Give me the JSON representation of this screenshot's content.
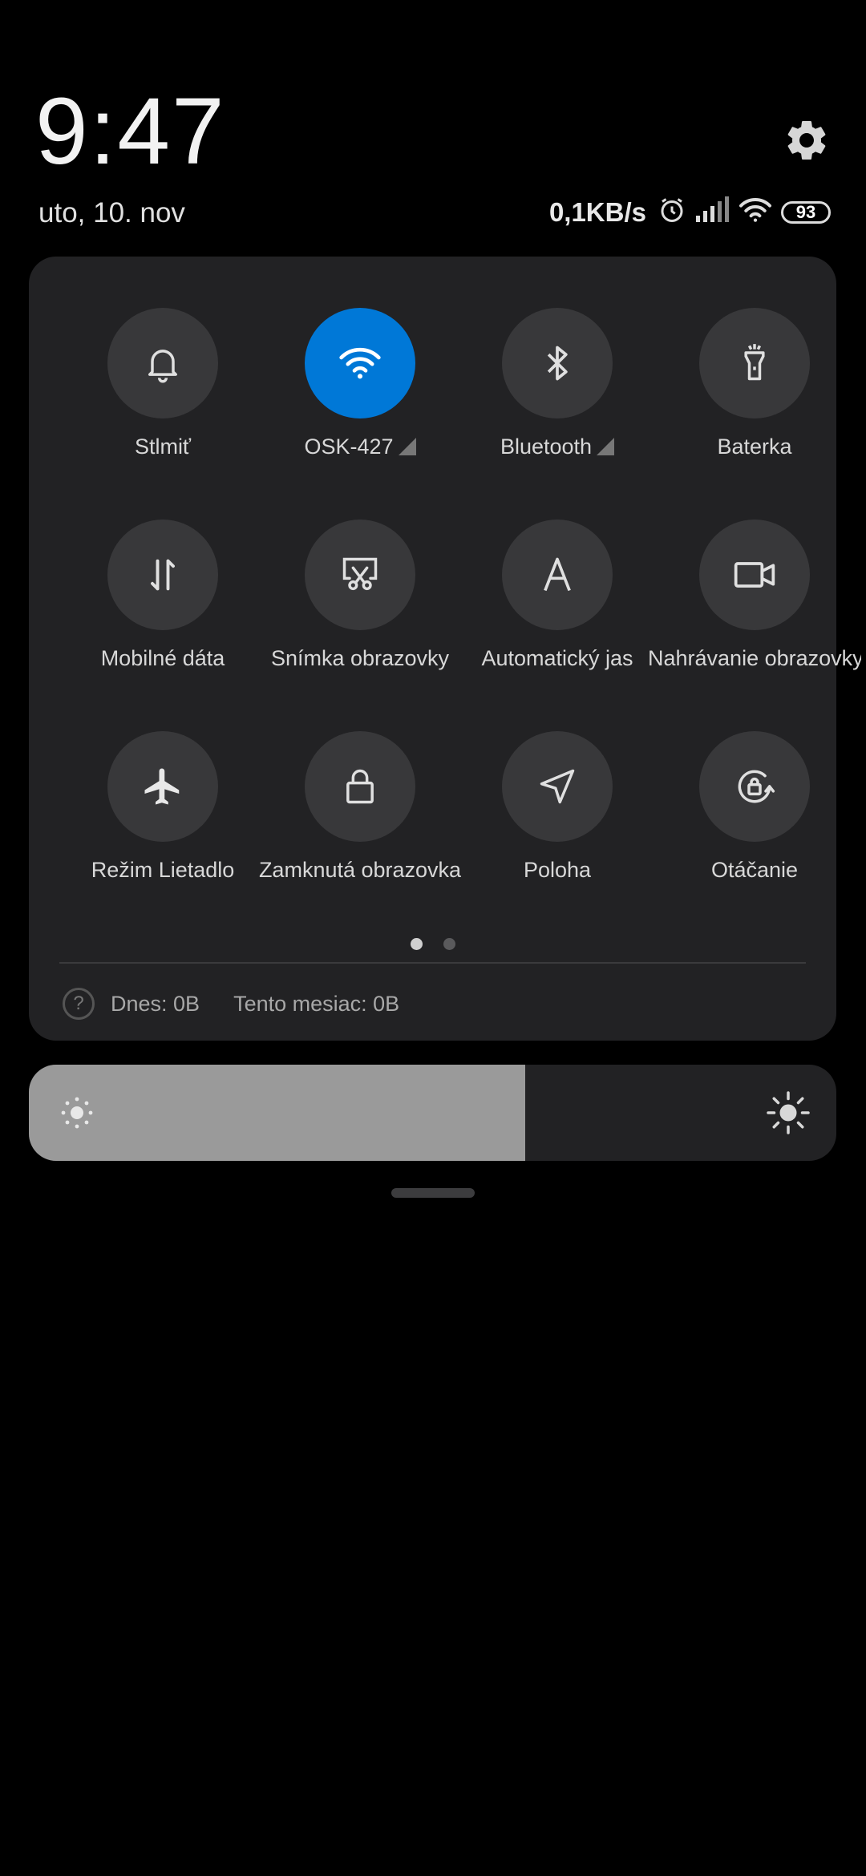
{
  "clock": "9:47",
  "date": "uto, 10. nov",
  "status": {
    "speed": "0,1KB/s",
    "battery": "93"
  },
  "tiles": [
    {
      "label": "Stlmiť"
    },
    {
      "label": "OSK-427",
      "active": true,
      "signal": true
    },
    {
      "label": "Bluetooth",
      "signal": true
    },
    {
      "label": "Baterka"
    },
    {
      "label": "Mobilné dáta"
    },
    {
      "label": "Snímka obrazovky"
    },
    {
      "label": "Automatický jas"
    },
    {
      "label": "Nahrávanie obrazovky"
    },
    {
      "label": "Režim Lietadlo"
    },
    {
      "label": "Zamknutá obrazovka"
    },
    {
      "label": "Poloha"
    },
    {
      "label": "Otáčanie"
    }
  ],
  "usage": {
    "today": "Dnes: 0B",
    "month": "Tento mesiac: 0B"
  },
  "brightness_level": 0.615,
  "pager": {
    "pages": 2,
    "current": 1
  },
  "colors": {
    "accent": "#0078d7",
    "panel": "#222224",
    "tile": "#38383a"
  }
}
